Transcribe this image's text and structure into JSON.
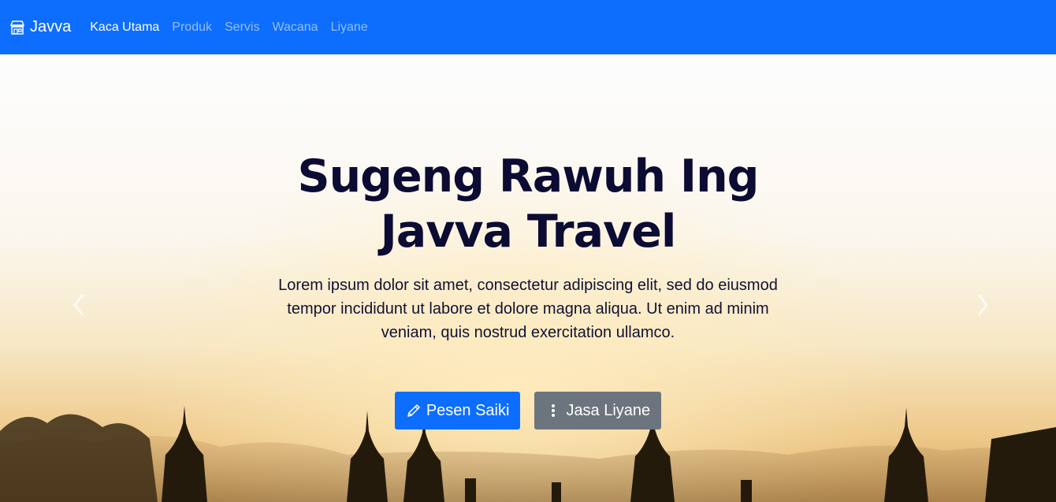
{
  "navbar": {
    "brand": "Javva",
    "brand_icon": "shop-icon",
    "links": [
      {
        "label": "Kaca Utama",
        "active": true
      },
      {
        "label": "Produk",
        "active": false
      },
      {
        "label": "Servis",
        "active": false
      },
      {
        "label": "Wacana",
        "active": false
      },
      {
        "label": "Liyane",
        "active": false
      }
    ],
    "bg_color": "#0d6efd"
  },
  "hero": {
    "title_line1": "Sugeng Rawuh Ing",
    "title_line2": "Javva Travel",
    "text": "Lorem ipsum dolor sit amet, consectetur adipiscing elit, sed do eiusmod tempor incididunt ut labore et dolore magna aliqua. Ut enim ad minim veniam, quis nostrud exercitation ullamco.",
    "primary_button": {
      "label": "Pesen Saiki",
      "icon": "pencil-icon",
      "color": "#0d6efd"
    },
    "secondary_button": {
      "label": "Jasa Liyane",
      "icon": "vertical-dots-icon",
      "color": "#6c757d"
    },
    "prev_icon": "chevron-left-icon",
    "next_icon": "chevron-right-icon"
  }
}
